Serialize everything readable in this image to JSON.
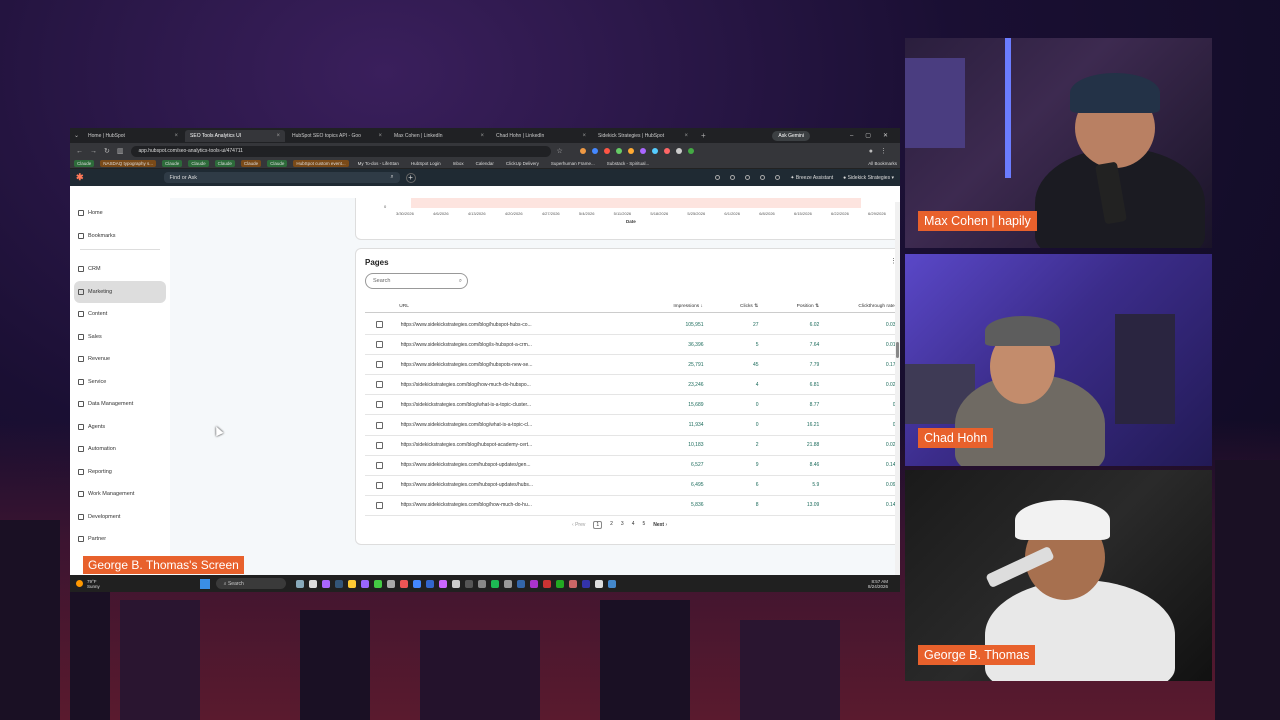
{
  "browser": {
    "tabs": [
      {
        "label": "Home | HubSpot",
        "active": false
      },
      {
        "label": "SEO Tools Analytics UI",
        "active": true
      },
      {
        "label": "HubSpot SEO topics API - Goo",
        "active": false
      },
      {
        "label": "Max Cohen | LinkedIn",
        "active": false
      },
      {
        "label": "Chad Hohn | LinkedIn",
        "active": false
      },
      {
        "label": "Sidekick Strategies | HubSpot",
        "active": false
      }
    ],
    "ask_gemini": "Ask Gemini",
    "url": "app.hubspot.com/seo-analytics-tools-ui/474711",
    "bookmarks": [
      {
        "label": "Claude",
        "style": "g"
      },
      {
        "label": "NASDAQ typography s...",
        "style": "o"
      },
      {
        "label": "Claude",
        "style": "g"
      },
      {
        "label": "Claude",
        "style": "g"
      },
      {
        "label": "Claude",
        "style": "g"
      },
      {
        "label": "Claude",
        "style": "o"
      },
      {
        "label": "Claude",
        "style": "g"
      },
      {
        "label": "HubSpot custom event...",
        "style": "o"
      },
      {
        "label": "My To-dos - LifeStan",
        "style": ""
      },
      {
        "label": "HubSpot Login",
        "style": ""
      },
      {
        "label": "Inbox",
        "style": ""
      },
      {
        "label": "Calendar",
        "style": ""
      },
      {
        "label": "ClickUp Delivery",
        "style": ""
      },
      {
        "label": "Superhuman Frame...",
        "style": ""
      },
      {
        "label": "Substack - Spiritual...",
        "style": ""
      },
      {
        "label": "All Bookmarks",
        "style": ""
      }
    ]
  },
  "hubspot": {
    "find_or_ask": "Find or Ask",
    "breeze_assistant": "Breeze Assistant",
    "account": "Sidekick Strategies",
    "nav": {
      "top": [
        "Home",
        "Bookmarks"
      ],
      "main": [
        "CRM",
        "Marketing",
        "Content",
        "Sales",
        "Revenue",
        "Service",
        "Data Management",
        "Agents",
        "Automation",
        "Reporting",
        "Work Management",
        "Development",
        "Partner"
      ],
      "active": "Marketing"
    }
  },
  "chart": {
    "y_zero": "0",
    "x_ticks": [
      "3/30/2026",
      "4/6/2026",
      "4/13/2026",
      "4/20/2026",
      "4/27/2026",
      "5/4/2026",
      "5/11/2026",
      "5/18/2026",
      "5/25/2026",
      "6/1/2026",
      "6/8/2026",
      "6/15/2026",
      "6/22/2026",
      "6/29/2026"
    ],
    "x_label": "Date"
  },
  "pages": {
    "title": "Pages",
    "search_placeholder": "Search",
    "columns": {
      "url": "URL",
      "impressions": "Impressions ↓",
      "clicks": "Clicks ⇅",
      "position": "Position ⇅",
      "ctr": "Clickthrough rate ⇅"
    },
    "rows": [
      {
        "url": "https://www.sidekickstrategies.com/blog/hubspot-hubs-co...",
        "impressions": "105,951",
        "clicks": "27",
        "position": "6.02",
        "ctr": "0.03%"
      },
      {
        "url": "https://www.sidekickstrategies.com/blog/is-hubspot-a-crm...",
        "impressions": "36,396",
        "clicks": "5",
        "position": "7.64",
        "ctr": "0.01%"
      },
      {
        "url": "https://www.sidekickstrategies.com/blog/hubspots-new-se...",
        "impressions": "25,791",
        "clicks": "45",
        "position": "7.79",
        "ctr": "0.17%"
      },
      {
        "url": "https://sidekickstrategies.com/blog/how-much-do-hubspo...",
        "impressions": "23,246",
        "clicks": "4",
        "position": "6.81",
        "ctr": "0.02%"
      },
      {
        "url": "https://sidekickstrategies.com/blog/what-is-a-topic-cluster...",
        "impressions": "15,689",
        "clicks": "0",
        "position": "8.77",
        "ctr": "0%"
      },
      {
        "url": "https://www.sidekickstrategies.com/blog/what-is-a-topic-cl...",
        "impressions": "11,934",
        "clicks": "0",
        "position": "16.21",
        "ctr": "0%"
      },
      {
        "url": "https://sidekickstrategies.com/blog/hubspot-academy-cert...",
        "impressions": "10,183",
        "clicks": "2",
        "position": "21.88",
        "ctr": "0.02%"
      },
      {
        "url": "https://www.sidekickstrategies.com/hubspot-updates/gen...",
        "impressions": "6,527",
        "clicks": "9",
        "position": "8.46",
        "ctr": "0.14%"
      },
      {
        "url": "https://www.sidekickstrategies.com/hubspot-updates/hubs...",
        "impressions": "6,495",
        "clicks": "6",
        "position": "5.9",
        "ctr": "0.09%"
      },
      {
        "url": "https://www.sidekickstrategies.com/blog/how-much-do-hu...",
        "impressions": "5,836",
        "clicks": "8",
        "position": "13.09",
        "ctr": "0.14%"
      }
    ],
    "pager": {
      "prev": "Prev",
      "pages": [
        "1",
        "2",
        "3",
        "4",
        "5"
      ],
      "current": "1",
      "next": "Next"
    }
  },
  "taskbar": {
    "temp": "79°F",
    "weather": "Sunny",
    "search": "Search",
    "time": "8:57 AM",
    "date": "8/24/2026"
  },
  "labels": {
    "screen": "George B. Thomas's Screen",
    "cam1": "Max Cohen | hapily",
    "cam2": "Chad Hohn",
    "cam3": "George B. Thomas"
  },
  "colors": {
    "label_bg": "#e8612c",
    "hubspot_orange": "#ff7a59",
    "metric_teal": "#1a6a5a"
  }
}
